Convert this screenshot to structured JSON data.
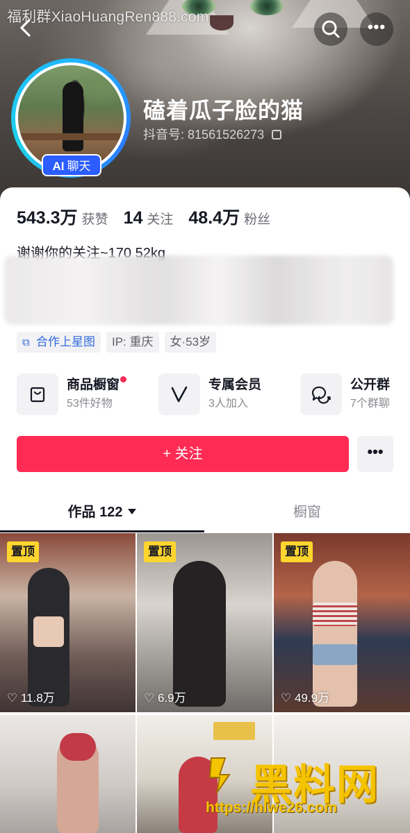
{
  "watermark_top": "福利群XiaoHuangRen888.com",
  "header": {
    "back_icon": "back-arrow-icon",
    "search_icon": "search-icon",
    "more_label": "•••"
  },
  "profile": {
    "ai_badge_prefix": "AI",
    "ai_badge_label": "聊天",
    "username": "磕着瓜子脸的猫",
    "douyin_id_label": "抖音号:",
    "douyin_id": "81561526273"
  },
  "stats": [
    {
      "value": "543.3万",
      "label": "获赞"
    },
    {
      "value": "14",
      "label": "关注"
    },
    {
      "value": "48.4万",
      "label": "粉丝"
    }
  ],
  "bio": "谢谢你的关注~170 52kg",
  "tags": [
    {
      "label": "合作上星图",
      "icon": "star-map-icon",
      "accent": "#2f6be0"
    },
    {
      "label": "IP: 重庆"
    },
    {
      "label": "女·53岁"
    }
  ],
  "features": [
    {
      "title": "商品橱窗",
      "subtitle": "53件好物",
      "icon": "shopping-bag-icon",
      "has_dot": true
    },
    {
      "title": "专属会员",
      "subtitle": "3人加入",
      "icon": "member-v-icon",
      "has_dot": false
    },
    {
      "title": "公开群",
      "subtitle": "7个群聊",
      "icon": "group-chat-icon",
      "has_dot": false
    }
  ],
  "actions": {
    "follow_label": "+ 关注",
    "more_label": "•••"
  },
  "tabs": {
    "works_label": "作品 122",
    "showcase_label": "橱窗"
  },
  "posts": [
    {
      "pinned_label": "置顶",
      "likes": "11.8万"
    },
    {
      "pinned_label": "置顶",
      "likes": "6.9万"
    },
    {
      "pinned_label": "置顶",
      "likes": "49.9万"
    },
    {
      "pinned_label": "",
      "likes": ""
    },
    {
      "pinned_label": "",
      "likes": ""
    },
    {
      "pinned_label": "",
      "likes": ""
    }
  ],
  "bottom_watermark": {
    "title": "黑料网",
    "url": "https://hlwe26.com"
  },
  "colors": {
    "accent_red": "#fe2c55",
    "pin_yellow": "#ffd52e",
    "ai_blue": "#2b5dff",
    "link_blue": "#2f6be0"
  }
}
